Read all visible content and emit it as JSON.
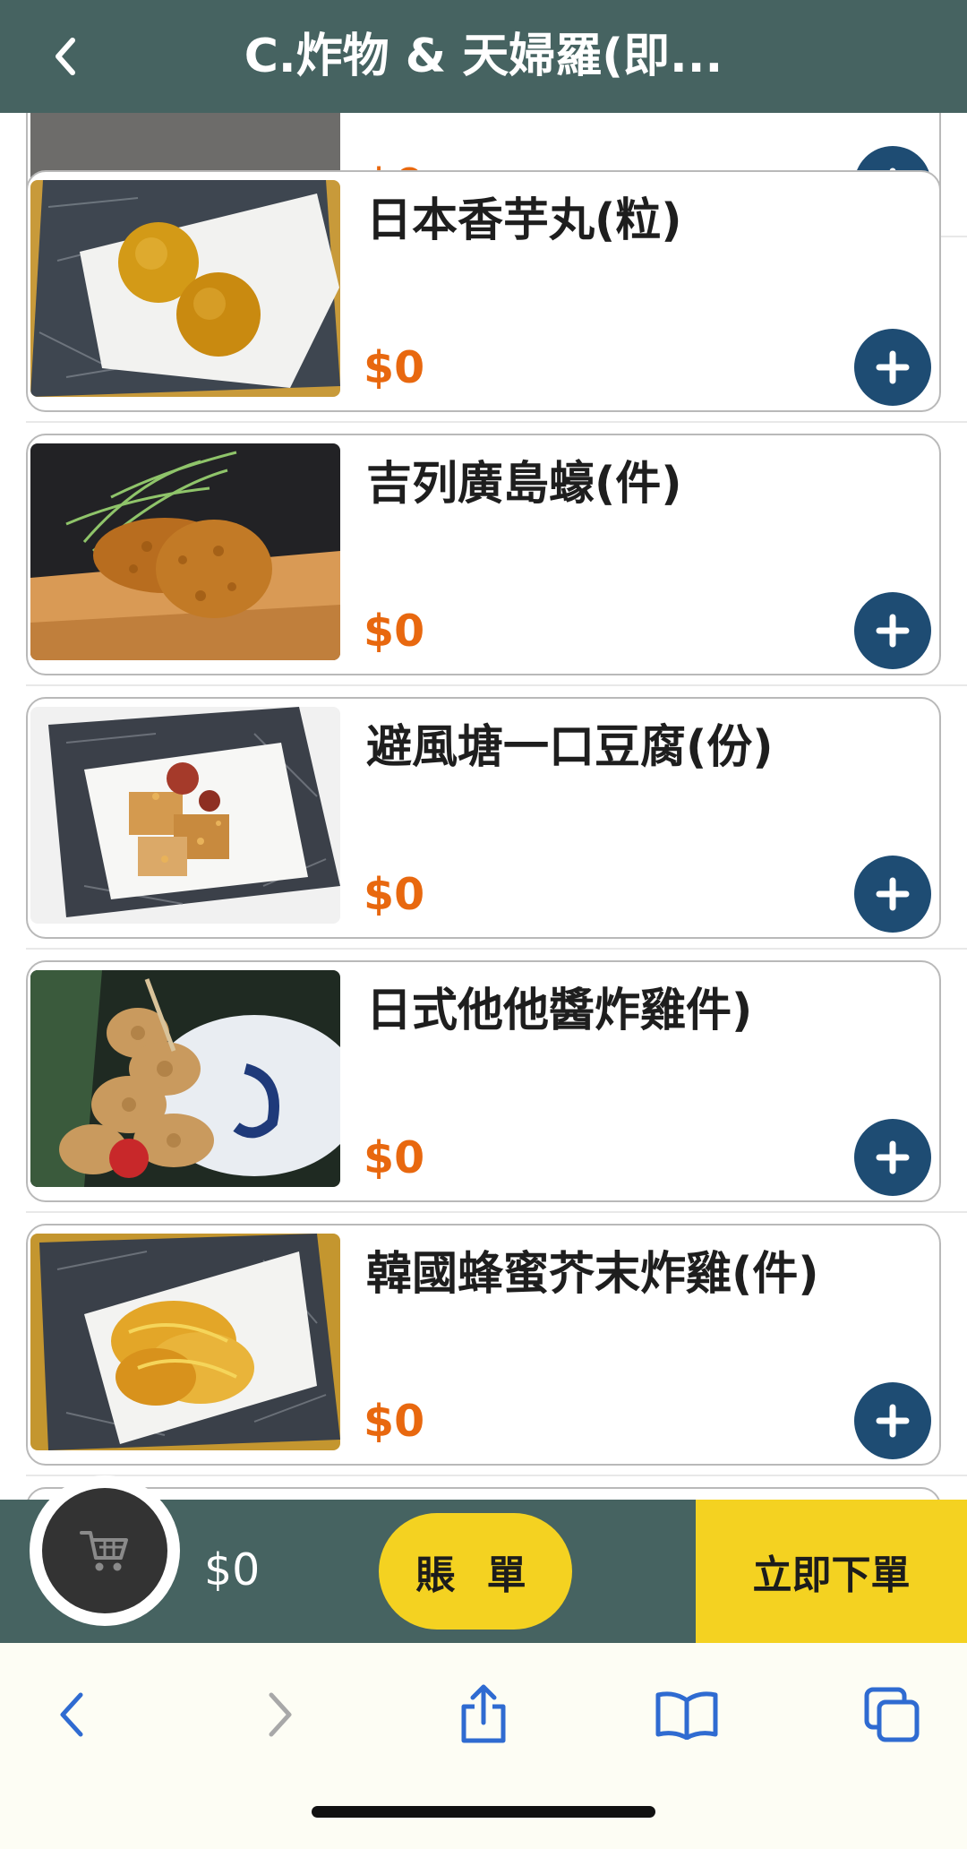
{
  "header": {
    "title": "C.炸物 & 天婦羅(即..."
  },
  "items": [
    {
      "name": "",
      "price": "$0"
    },
    {
      "name": "日本香芋丸(粒)",
      "price": "$0"
    },
    {
      "name": "吉列廣島蠔(件)",
      "price": "$0"
    },
    {
      "name": "避風塘一口豆腐(份)",
      "price": "$0"
    },
    {
      "name": "日式他他醬炸雞件)",
      "price": "$0"
    },
    {
      "name": "韓國蜂蜜芥末炸雞(件)",
      "price": "$0"
    }
  ],
  "order_bar": {
    "cart_total": "$0",
    "bill_label": "賬 單",
    "order_now_label": "立即下單"
  },
  "icons": {
    "back": "chevron-left-icon",
    "add": "plus-icon",
    "cart": "shopping-cart-icon",
    "browser_back": "chevron-left-icon",
    "browser_forward": "chevron-right-icon",
    "share": "share-icon",
    "bookmarks": "book-icon",
    "tabs": "tabs-icon"
  },
  "colors": {
    "header_bg": "#466361",
    "price": "#e8680f",
    "add_button": "#1e4c73",
    "accent_yellow": "#f4d221",
    "browser_tint": "#2f6bd1"
  }
}
